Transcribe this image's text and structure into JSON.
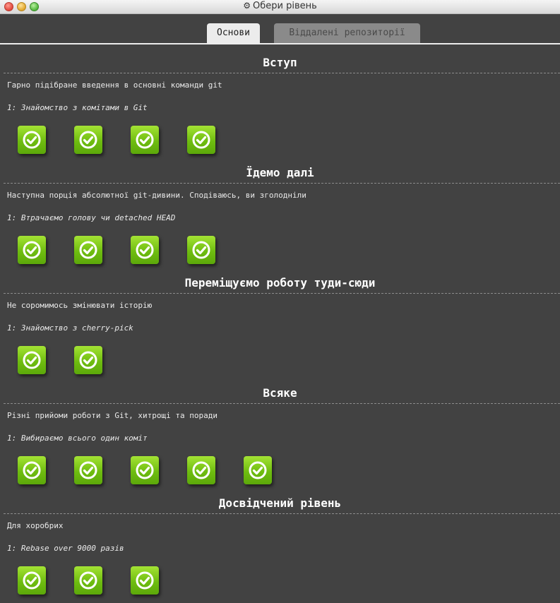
{
  "window": {
    "title": "Обери рівень",
    "title_icon": "gear-icon"
  },
  "tabs": [
    {
      "label": "Основи",
      "active": true
    },
    {
      "label": "Віддалені репозиторії",
      "active": false
    }
  ],
  "sequences": [
    {
      "title": "Вступ",
      "description": "Гарно підібране введення в основні команди git",
      "current_level": "1: Знайомство з комітами в Git",
      "level_count": 4
    },
    {
      "title": "Їдемо далі",
      "description": "Наступна порція абсолютної git-дивини. Сподіваюсь, ви зголодніли",
      "current_level": "1: Втрачаємо голову чи detached HEAD",
      "level_count": 4
    },
    {
      "title": "Переміщуємо роботу туди-сюди",
      "description": "Не соромимось змінювати історію",
      "current_level": "1: Знайомство з cherry-pick",
      "level_count": 2
    },
    {
      "title": "Всяке",
      "description": "Різні прийоми роботи з Git, хитрощі та поради",
      "current_level": "1: Вибираємо всього один коміт",
      "level_count": 5
    },
    {
      "title": "Досвідчений рівень",
      "description": "Для хоробрих",
      "current_level": "1: Rebase over 9000 разів",
      "level_count": 3
    }
  ],
  "level_status": "completed",
  "colors": {
    "background": "#424242",
    "level_complete": "#7cc41a",
    "tab_active": "#ececec"
  }
}
